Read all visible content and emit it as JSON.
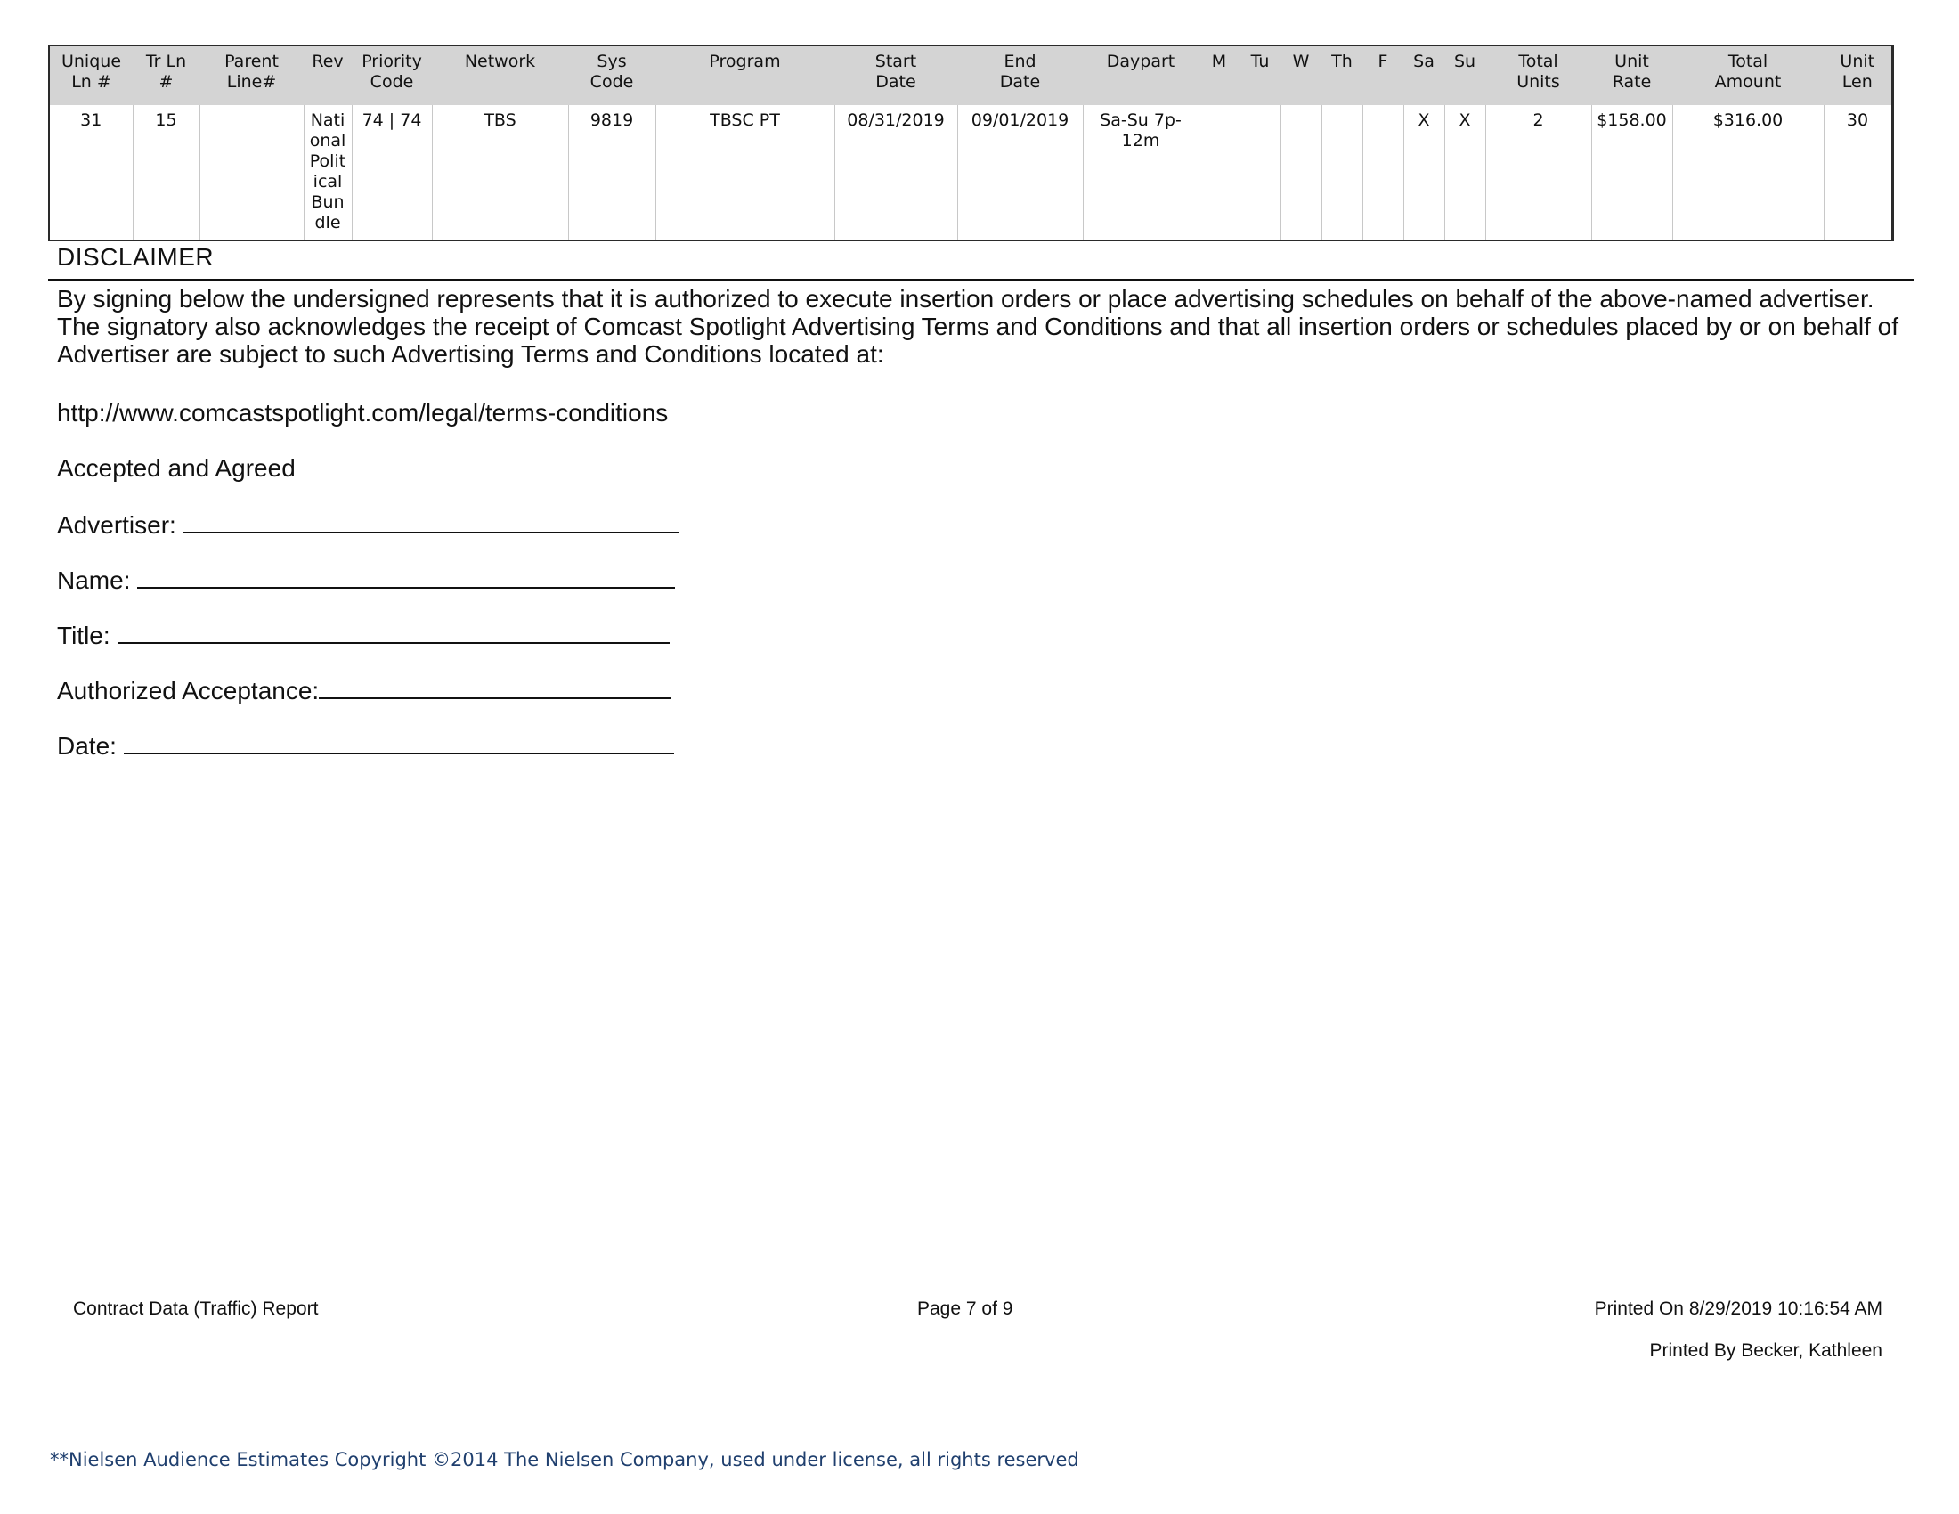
{
  "schedule": {
    "columns": [
      "Unique\nLn #",
      "Tr Ln\n#",
      "Parent\nLine#",
      "Rev",
      "Priority\nCode",
      "Network",
      "Sys\nCode",
      "Program",
      "Start\nDate",
      "End\nDate",
      "Daypart",
      "M",
      "Tu",
      "W",
      "Th",
      "F",
      "Sa",
      "Su",
      "Total\nUnits",
      "Unit\nRate",
      "Total\nAmount",
      "Unit\nLen"
    ],
    "rows": [
      [
        "31",
        "15",
        "",
        "National Political Bundle",
        "74 | 74",
        "TBS",
        "9819",
        "TBSC PT",
        "08/31/2019",
        "09/01/2019",
        "Sa-Su 7p-12m",
        "",
        "",
        "",
        "",
        "",
        "X",
        "X",
        "2",
        "$158.00",
        "$316.00",
        "30"
      ]
    ]
  },
  "disclaimer": {
    "heading": "DISCLAIMER",
    "line1": "By signing below the undersigned represents that it is authorized to execute insertion orders or place advertising schedules on behalf of the above-named advertiser.",
    "line2": "The signatory also acknowledges the receipt of Comcast Spotlight Advertising Terms and Conditions and that all insertion orders or schedules placed by or on behalf of",
    "line3": "Advertiser are subject to such Advertising Terms and Conditions located at:",
    "url": "http://www.comcastspotlight.com/legal/terms-conditions",
    "accepted": "Accepted and Agreed"
  },
  "signature_fields": {
    "advertiser": "Advertiser:",
    "name": "Name:",
    "title": "Title:",
    "authorized": "Authorized Acceptance:",
    "date": "Date:"
  },
  "footer": {
    "report_name": "Contract Data (Traffic) Report",
    "page": "Page 7 of 9",
    "printed_on": "Printed On 8/29/2019 10:16:54 AM",
    "printed_by": "Printed By Becker, Kathleen",
    "copyright": "**Nielsen Audience Estimates Copyright ©2014 The Nielsen Company, used under license, all rights reserved"
  }
}
